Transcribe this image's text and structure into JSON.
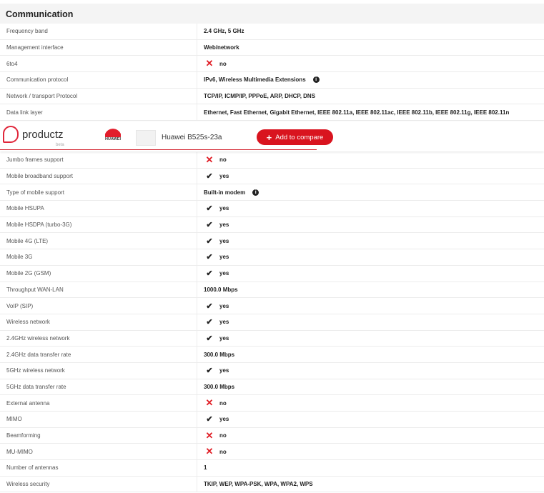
{
  "section_title": "Communication",
  "rows_top": [
    {
      "label": "Frequency band",
      "value": "2.4 GHz, 5 GHz",
      "type": "text"
    },
    {
      "label": "Management interface",
      "value": "Web/network",
      "type": "text"
    },
    {
      "label": "6to4",
      "value": "no",
      "type": "no"
    },
    {
      "label": "Communication protocol",
      "value": "IPv6, Wireless Multimedia Extensions",
      "type": "info"
    },
    {
      "label": "Network / transport Protocol",
      "value": "TCP/IP, ICMP/IP, PPPoE, ARP, DHCP, DNS",
      "type": "text"
    },
    {
      "label": "Data link layer",
      "value": "Ethernet, Fast Ethernet, Gigabit Ethernet, IEEE 802.11a, IEEE 802.11ac, IEEE 802.11b, IEEE 802.11g, IEEE 802.11n",
      "type": "text"
    }
  ],
  "sticky": {
    "brand": "productz",
    "beta": "beta",
    "maker": "HUAWEI",
    "product": "Huawei B525s-23a",
    "add_label": "Add to compare",
    "accent": "#d9141f"
  },
  "rows_bottom": [
    {
      "label": "Jumbo frames support",
      "value": "no",
      "type": "no"
    },
    {
      "label": "Mobile broadband support",
      "value": "yes",
      "type": "yes"
    },
    {
      "label": "Type of mobile support",
      "value": "Built-in modem",
      "type": "info"
    },
    {
      "label": "Mobile HSUPA",
      "value": "yes",
      "type": "yes"
    },
    {
      "label": "Mobile HSDPA (turbo-3G)",
      "value": "yes",
      "type": "yes"
    },
    {
      "label": "Mobile 4G (LTE)",
      "value": "yes",
      "type": "yes"
    },
    {
      "label": "Mobile 3G",
      "value": "yes",
      "type": "yes"
    },
    {
      "label": "Mobile 2G (GSM)",
      "value": "yes",
      "type": "yes"
    },
    {
      "label": "Throughput WAN-LAN",
      "value": "1000.0 Mbps",
      "type": "text"
    },
    {
      "label": "VoIP (SIP)",
      "value": "yes",
      "type": "yes"
    },
    {
      "label": "Wireless network",
      "value": "yes",
      "type": "yes"
    },
    {
      "label": "2.4GHz wireless network",
      "value": "yes",
      "type": "yes"
    },
    {
      "label": "2.4GHz data transfer rate",
      "value": "300.0 Mbps",
      "type": "text"
    },
    {
      "label": "5GHz wireless network",
      "value": "yes",
      "type": "yes"
    },
    {
      "label": "5GHz data transfer rate",
      "value": "300.0 Mbps",
      "type": "text"
    },
    {
      "label": "External antenna",
      "value": "no",
      "type": "no"
    },
    {
      "label": "MIMO",
      "value": "yes",
      "type": "yes"
    },
    {
      "label": "Beamforming",
      "value": "no",
      "type": "no"
    },
    {
      "label": "MU-MIMO",
      "value": "no",
      "type": "no"
    },
    {
      "label": "Number of antennas",
      "value": "1",
      "type": "text"
    },
    {
      "label": "Wireless security",
      "value": "TKIP, WEP, WPA-PSK, WPA, WPA2, WPS",
      "type": "text"
    }
  ]
}
